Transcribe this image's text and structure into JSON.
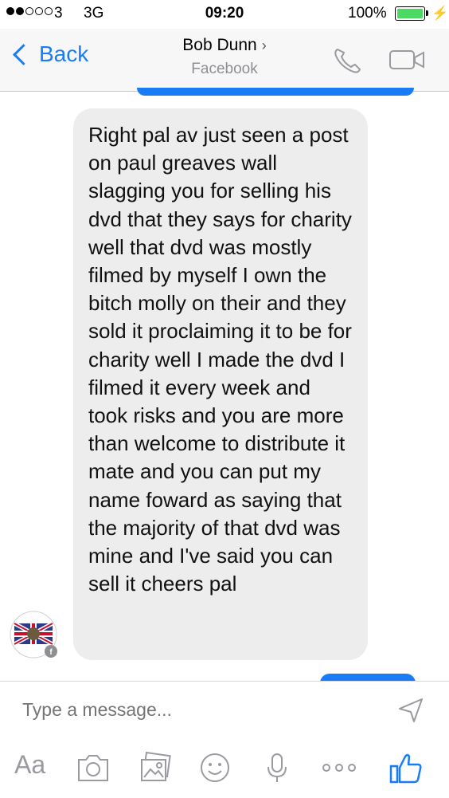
{
  "status_bar": {
    "carrier": "3",
    "network": "3G",
    "time": "09:20",
    "battery": "100%"
  },
  "nav": {
    "back_label": "Back",
    "title": "Bob Dunn",
    "subtitle": "Facebook"
  },
  "messages": [
    {
      "text": "Right pal av just seen a post on paul greaves wall slagging you for selling his dvd that they says for charity well that dvd was mostly filmed by myself I own the bitch molly on their and they sold it proclaiming it to be for charity well I made the dvd I filmed it every week and took risks and you are more than welcome to distribute it mate and you can put my name foward as saying that the majority of that dvd was mine and I've said you can sell it cheers pal"
    }
  ],
  "composer": {
    "placeholder": "Type a message...",
    "text_format_label": "Aa"
  },
  "colors": {
    "accent": "#1a7cf5",
    "bubble_incoming": "#ededee",
    "battery": "#4cd964"
  }
}
